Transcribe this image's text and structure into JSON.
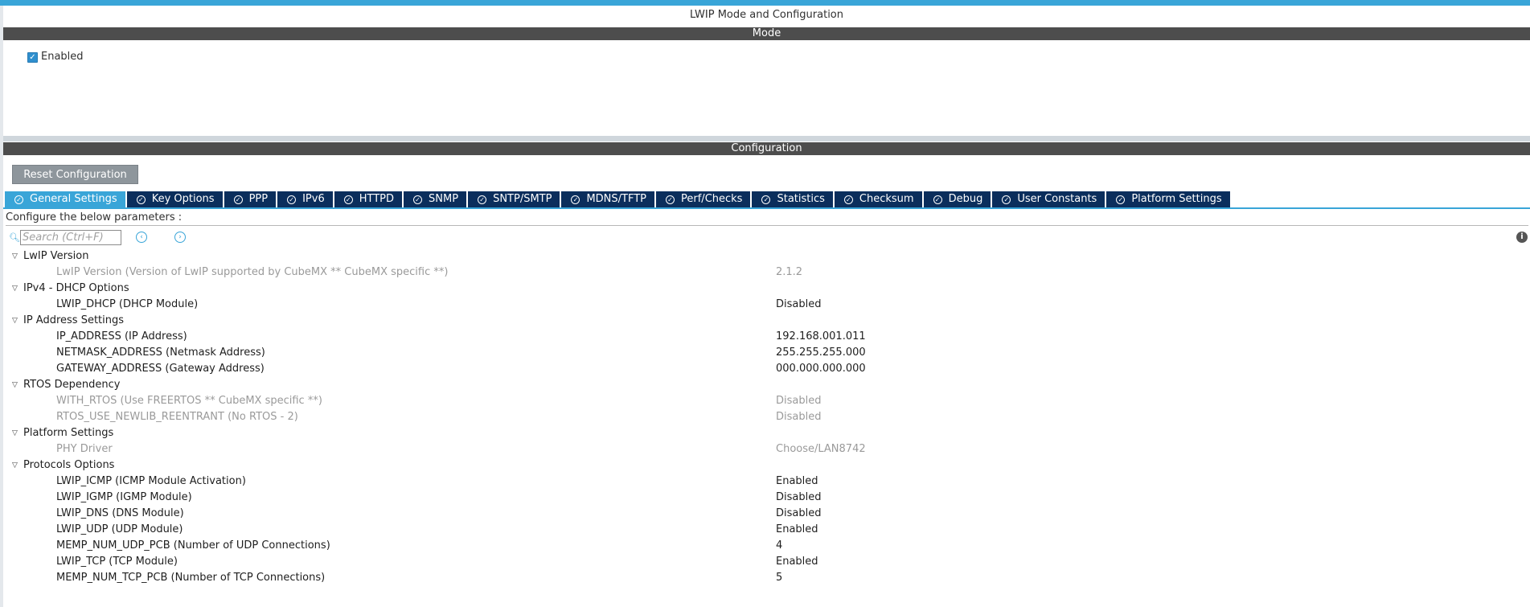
{
  "window": {
    "title": "LWIP Mode and Configuration"
  },
  "mode": {
    "section_title": "Mode",
    "enabled_label": "Enabled",
    "enabled_checked": true
  },
  "configuration": {
    "section_title": "Configuration",
    "reset_label": "Reset Configuration",
    "tabs": [
      {
        "label": "General Settings",
        "active": true
      },
      {
        "label": "Key Options"
      },
      {
        "label": "PPP"
      },
      {
        "label": "IPv6"
      },
      {
        "label": "HTTPD"
      },
      {
        "label": "SNMP"
      },
      {
        "label": "SNTP/SMTP"
      },
      {
        "label": "MDNS/TFTP"
      },
      {
        "label": "Perf/Checks"
      },
      {
        "label": "Statistics"
      },
      {
        "label": "Checksum"
      },
      {
        "label": "Debug"
      },
      {
        "label": "User Constants"
      },
      {
        "label": "Platform Settings"
      }
    ],
    "caption": "Configure the below parameters :",
    "search_placeholder": "Search (Ctrl+F)"
  },
  "groups": [
    {
      "name": "LwIP Version",
      "params": [
        {
          "label": "LwIP Version (Version of LwIP supported by CubeMX ** CubeMX specific **)",
          "value": "2.1.2",
          "disabled": true
        }
      ]
    },
    {
      "name": "IPv4 - DHCP Options",
      "params": [
        {
          "label": "LWIP_DHCP (DHCP Module)",
          "value": "Disabled"
        }
      ]
    },
    {
      "name": "IP Address Settings",
      "params": [
        {
          "label": "IP_ADDRESS (IP Address)",
          "value": "192.168.001.011"
        },
        {
          "label": "NETMASK_ADDRESS (Netmask Address)",
          "value": "255.255.255.000"
        },
        {
          "label": "GATEWAY_ADDRESS (Gateway Address)",
          "value": "000.000.000.000"
        }
      ]
    },
    {
      "name": "RTOS Dependency",
      "params": [
        {
          "label": "WITH_RTOS (Use FREERTOS ** CubeMX specific **)",
          "value": "Disabled",
          "disabled": true
        },
        {
          "label": "RTOS_USE_NEWLIB_REENTRANT (No RTOS - 2)",
          "value": "Disabled",
          "disabled": true
        }
      ]
    },
    {
      "name": "Platform Settings",
      "params": [
        {
          "label": "PHY Driver",
          "value": "Choose/LAN8742",
          "disabled": true
        }
      ]
    },
    {
      "name": "Protocols Options",
      "params": [
        {
          "label": "LWIP_ICMP (ICMP Module Activation)",
          "value": "Enabled"
        },
        {
          "label": "LWIP_IGMP (IGMP Module)",
          "value": "Disabled"
        },
        {
          "label": "LWIP_DNS (DNS Module)",
          "value": "Disabled"
        },
        {
          "label": "LWIP_UDP (UDP Module)",
          "value": "Enabled"
        },
        {
          "label": "MEMP_NUM_UDP_PCB (Number of UDP Connections)",
          "value": "4"
        },
        {
          "label": "LWIP_TCP (TCP Module)",
          "value": "Enabled"
        },
        {
          "label": "MEMP_NUM_TCP_PCB (Number of TCP Connections)",
          "value": "5"
        }
      ]
    }
  ],
  "colors": {
    "accent": "#39a5d8",
    "tab_bg": "#0b2e5c",
    "section_bar": "#4d4d4d",
    "disabled_text": "#9a9a9a"
  }
}
